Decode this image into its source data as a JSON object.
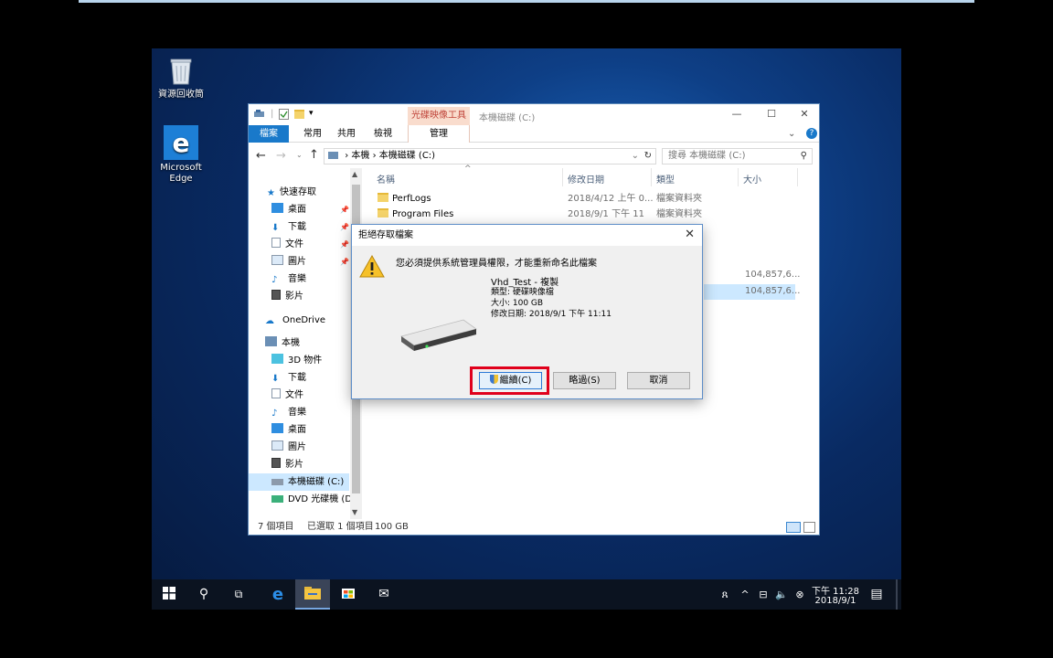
{
  "desktop": {
    "recycle_bin_label": "資源回收筒",
    "edge_label_line1": "Microsoft",
    "edge_label_line2": "Edge"
  },
  "explorer": {
    "contextual_tab": "光碟映像工具",
    "window_title": "本機磁碟 (C:)",
    "ribbon_tabs": [
      "檔案",
      "常用",
      "共用",
      "檢視",
      "管理"
    ],
    "breadcrumb": [
      "本機",
      "本機磁碟 (C:)"
    ],
    "search_placeholder": "搜尋 本機磁碟 (C:)",
    "columns": [
      "名稱",
      "修改日期",
      "類型",
      "大小"
    ],
    "files": [
      {
        "name": "PerfLogs",
        "date": "2018/4/12 上午 0...",
        "type": "檔案資料夾",
        "size": ""
      },
      {
        "name": "Program Files",
        "date": "2018/9/1 下午 11",
        "type": "檔案資料夾",
        "size": ""
      }
    ],
    "partial_sizes": [
      "104,857,6...",
      "104,857,6..."
    ],
    "nav": {
      "quick_access": "快速存取",
      "desktop": "桌面",
      "downloads": "下載",
      "documents": "文件",
      "pictures": "圖片",
      "music": "音樂",
      "videos": "影片",
      "onedrive": "OneDrive",
      "this_pc": "本機",
      "objects3d": "3D 物件",
      "pc_downloads": "下載",
      "pc_documents": "文件",
      "pc_music": "音樂",
      "pc_desktop": "桌面",
      "pc_pictures": "圖片",
      "pc_videos": "影片",
      "local_disk": "本機磁碟 (C:)",
      "dvd": "DVD 光碟機 (D:)"
    },
    "status": {
      "items": "7 個項目",
      "selected": "已選取 1 個項目",
      "size": "100 GB"
    }
  },
  "dialog": {
    "title": "拒絕存取檔案",
    "message": "您必須提供系統管理員權限，才能重新命名此檔案",
    "file_name": "Vhd_Test - 複製",
    "file_type": "類型: 硬碟映像檔",
    "file_size": "大小: 100 GB",
    "file_date": "修改日期: 2018/9/1 下午 11:11",
    "continue_label": "繼續(C)",
    "skip_label": "略過(S)",
    "cancel_label": "取消"
  },
  "taskbar": {
    "time": "下午 11:28",
    "date": "2018/9/1"
  },
  "colors": {
    "accent": "#1979ca",
    "highlight": "#e0001b",
    "contextual_tab": "#f9dccd"
  }
}
